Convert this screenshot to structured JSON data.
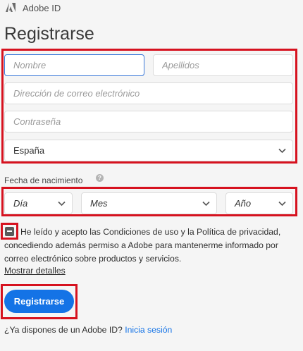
{
  "header": {
    "brand": "Adobe ID",
    "logo_icon": "adobe-logo-icon"
  },
  "page_title": "Registrarse",
  "form": {
    "first_name_placeholder": "Nombre",
    "last_name_placeholder": "Apellidos",
    "email_placeholder": "Dirección de correo electrónico",
    "password_placeholder": "Contraseña",
    "country_value": "España"
  },
  "dob": {
    "label": "Fecha de nacimiento",
    "help_icon": "?",
    "day": "Día",
    "month": "Mes",
    "year": "Año"
  },
  "consent": {
    "text": "He leído y acepto las Condiciones de uso y la Política de privacidad, concediendo además permiso a Adobe para mantenerme informado por correo electrónico sobre productos y servicios.",
    "show_details": "Mostrar detalles"
  },
  "submit_label": "Registrarse",
  "signin": {
    "prompt": "¿Ya dispones de un Adobe ID?",
    "link": "Inicia sesión"
  },
  "colors": {
    "accent": "#1473e6",
    "highlight": "#d6121f",
    "background": "#f5f5f5"
  }
}
